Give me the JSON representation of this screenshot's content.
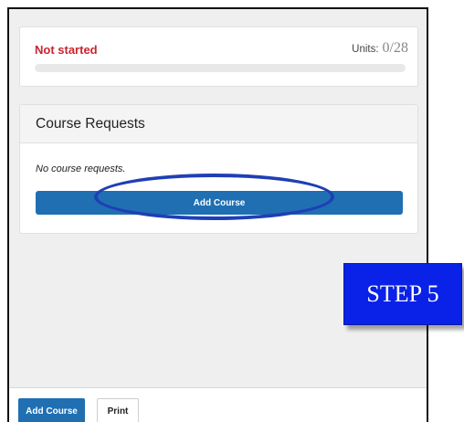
{
  "progress": {
    "status": "Not started",
    "units_label": "Units:",
    "units_value": "0/28",
    "completed_fraction": 0
  },
  "course_requests": {
    "title": "Course Requests",
    "empty_message": "No course requests.",
    "add_button_label": "Add Course"
  },
  "footer": {
    "add_course_label": "Add Course",
    "print_label": "Print"
  },
  "annotation": {
    "step_label": "STEP 5"
  },
  "colors": {
    "status_red": "#c8242f",
    "primary_blue": "#1f6fb2",
    "highlight_blue": "#1f3fb5",
    "step_badge_blue": "#0a21e8"
  }
}
